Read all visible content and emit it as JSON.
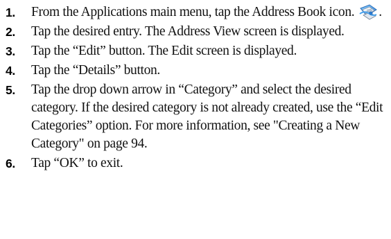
{
  "steps": [
    {
      "number": "1.",
      "text": "From the Applications main menu, tap the Address Book icon.",
      "suffix": ".",
      "icon": "address-book-icon"
    },
    {
      "number": "2.",
      "text": "Tap the desired entry. The Address View screen is displayed."
    },
    {
      "number": "3.",
      "text": "Tap the “Edit” button. The Edit screen is displayed."
    },
    {
      "number": "4.",
      "text": "Tap the “Details” button."
    },
    {
      "number": "5.",
      "text": "Tap the drop down arrow in “Category” and select the desired category. If the desired category is not already created, use the “Edit Categories” option. For more information, see \"Creating a New Category\" on page 94."
    },
    {
      "number": "6.",
      "text": "Tap “OK” to exit."
    }
  ]
}
